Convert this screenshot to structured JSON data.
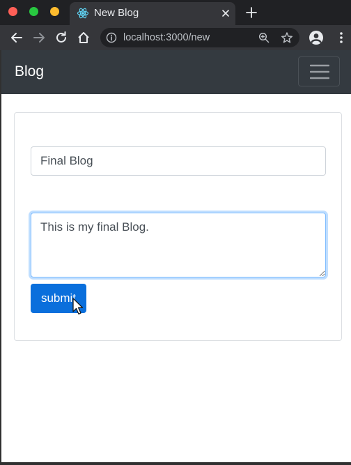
{
  "browser": {
    "tab": {
      "title": "New Blog",
      "favicon": "react-logo-icon"
    },
    "address_bar": {
      "url": "localhost:3000/new"
    },
    "icons": [
      "back-arrow-icon",
      "forward-arrow-icon",
      "reload-icon",
      "home-icon",
      "info-icon",
      "zoom-icon",
      "star-icon",
      "account-icon",
      "more-vert-icon",
      "close-icon",
      "plus-icon"
    ]
  },
  "navbar": {
    "brand": "Blog",
    "background": "#343a40"
  },
  "form": {
    "title_value": "Final Blog",
    "body_value": "This is my final Blog.",
    "submit_label": "submit",
    "accent": "#0a6fdc"
  }
}
